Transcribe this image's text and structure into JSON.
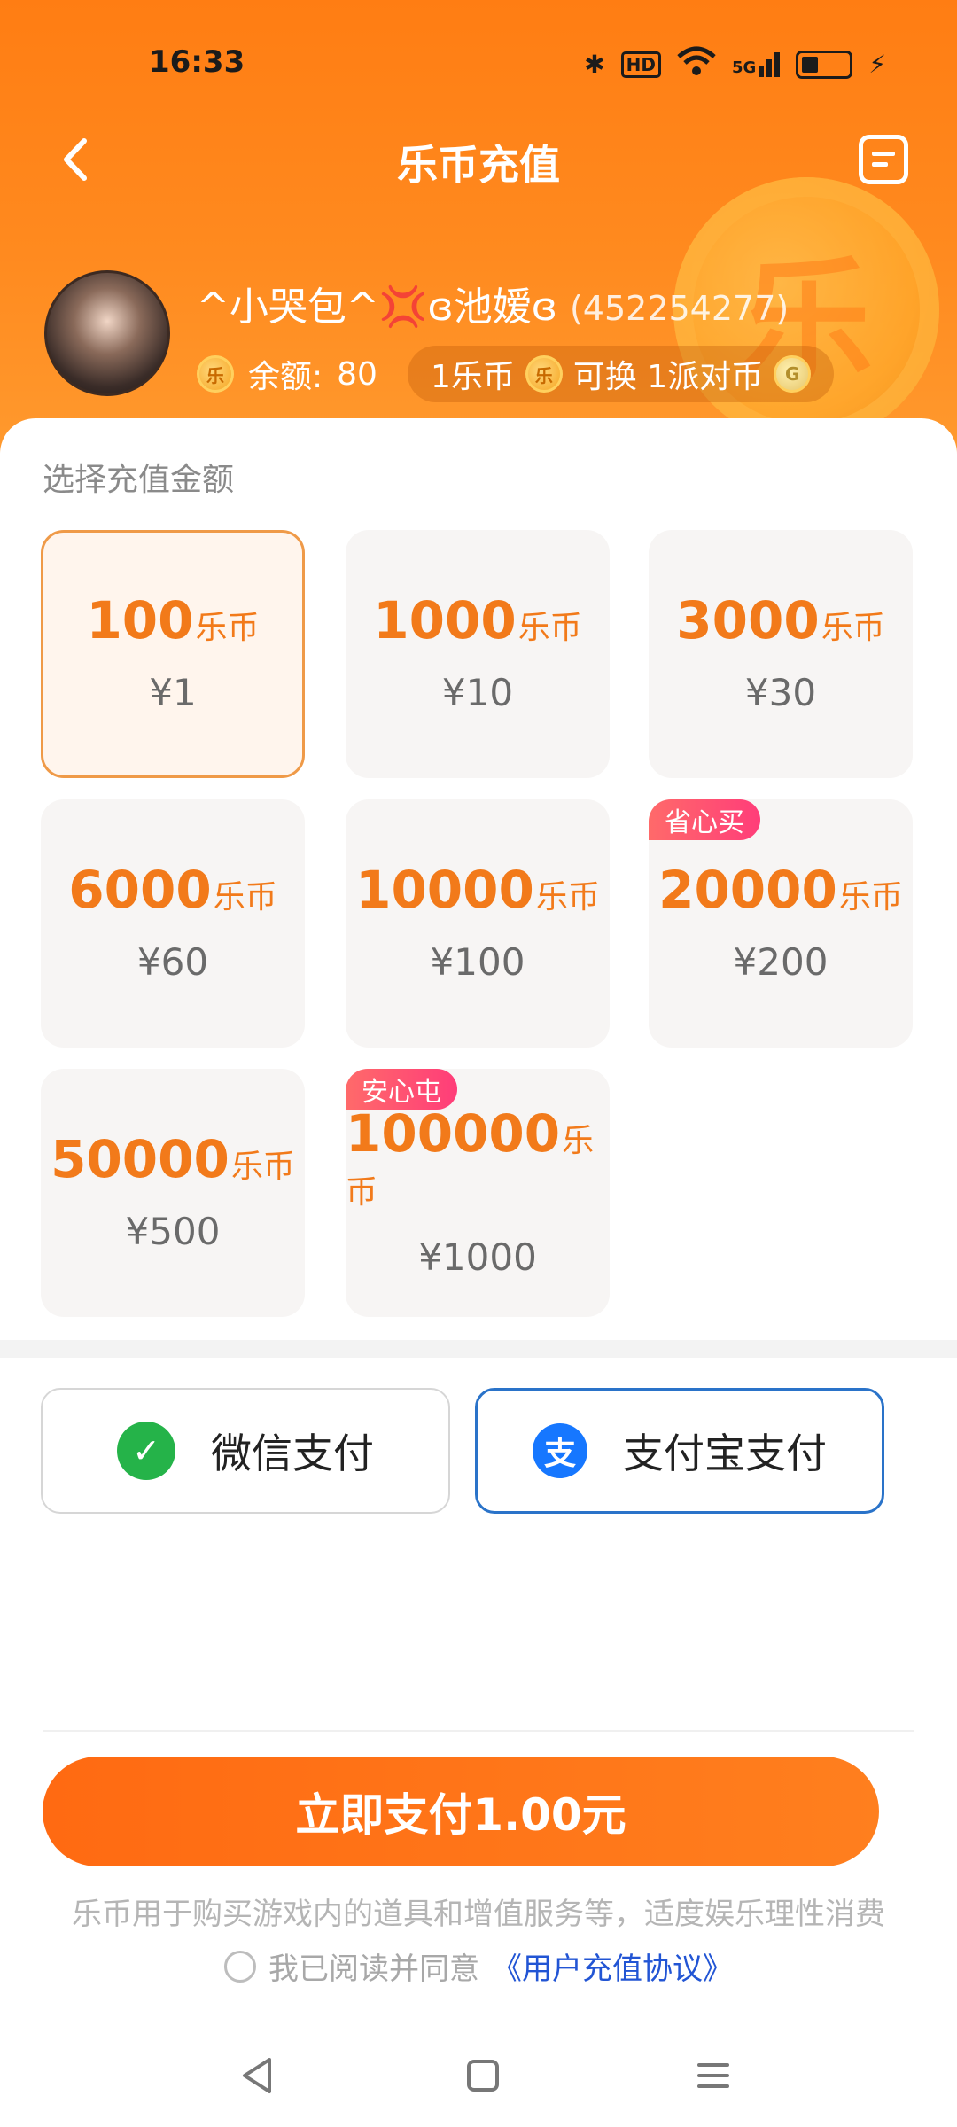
{
  "status_bar": {
    "time": "16:33",
    "bluetooth": "✱",
    "hd": "HD",
    "network": "5G"
  },
  "nav": {
    "title": "乐币充值"
  },
  "user": {
    "name": "^小哭包^💢ɞ池嫒ɞ",
    "uid": "(452254277)",
    "balance_label": "余额:",
    "balance_value": "80",
    "exchange_text_1": "1乐币",
    "exchange_text_2": "可换 1派对币",
    "coin_glyph": "乐",
    "party_glyph": "G"
  },
  "section_label": "选择充值金额",
  "unit": "乐币",
  "packages": [
    {
      "coins": "100",
      "price": "¥1",
      "badge": ""
    },
    {
      "coins": "1000",
      "price": "¥10",
      "badge": ""
    },
    {
      "coins": "3000",
      "price": "¥30",
      "badge": ""
    },
    {
      "coins": "6000",
      "price": "¥60",
      "badge": ""
    },
    {
      "coins": "10000",
      "price": "¥100",
      "badge": ""
    },
    {
      "coins": "20000",
      "price": "¥200",
      "badge": "省心买"
    },
    {
      "coins": "50000",
      "price": "¥500",
      "badge": ""
    },
    {
      "coins": "100000",
      "price": "¥1000",
      "badge": "安心屯"
    }
  ],
  "payment": {
    "wechat_label": "微信支付",
    "wechat_glyph": "✓",
    "alipay_label": "支付宝支付",
    "alipay_glyph": "支",
    "selected": "alipay"
  },
  "pay_button": "立即支付1.00元",
  "notice": "乐币用于购买游戏内的道具和增值服务等，适度娱乐理性消费",
  "agreement": {
    "prefix": "我已阅读并同意",
    "link": "《用户充值协议》"
  },
  "colors": {
    "accent": "#ff7d13",
    "price_text": "#f27a1a",
    "alipay_border": "#2a73c9"
  }
}
